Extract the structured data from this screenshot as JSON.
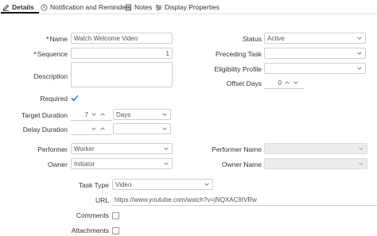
{
  "tabs": [
    {
      "label": "Details",
      "icon": "pencil-icon",
      "active": true
    },
    {
      "label": "Notification and Reminders",
      "icon": "clock-icon",
      "active": false
    },
    {
      "label": "Notes",
      "icon": "notes-icon",
      "active": false
    },
    {
      "label": "Display Properties",
      "icon": "sliders-icon",
      "active": false
    }
  ],
  "form": {
    "name": {
      "label": "Name",
      "value": "Watch Welcome Video"
    },
    "sequence": {
      "label": "Sequence",
      "value": "1"
    },
    "description": {
      "label": "Description"
    },
    "required": {
      "label": "Required",
      "checked": true
    },
    "target_duration": {
      "label": "Target Duration",
      "value": "7",
      "unit": "Days"
    },
    "delay_duration": {
      "label": "Delay Duration",
      "value": "",
      "unit": ""
    },
    "performer": {
      "label": "Performer",
      "value": "Worker"
    },
    "owner": {
      "label": "Owner",
      "value": "Initiator"
    },
    "status": {
      "label": "Status",
      "value": "Active"
    },
    "preceding_task": {
      "label": "Preceding Task",
      "value": ""
    },
    "eligibility_profile": {
      "label": "Eligibility Profile",
      "value": ""
    },
    "offset_days": {
      "label": "Offset Days",
      "value": "0"
    },
    "performer_name": {
      "label": "Performer Name",
      "value": ""
    },
    "owner_name": {
      "label": "Owner Name",
      "value": ""
    },
    "task_type": {
      "label": "Task Type",
      "value": "Video"
    },
    "url": {
      "label": "URL",
      "value": "https://www.youtube.com/watch?v=jNQXAC9IVRw"
    },
    "comments": {
      "label": "Comments",
      "checked": false
    },
    "attachments": {
      "label": "Attachments",
      "checked": false
    }
  },
  "colors": {
    "required_asterisk": "#1e6fd9",
    "check": "#1e6fd9",
    "disabled_bg": "#ececec"
  }
}
